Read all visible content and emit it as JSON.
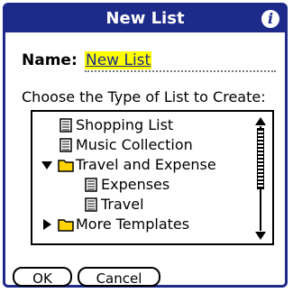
{
  "dialog": {
    "title": "New List",
    "info_icon": "info-icon"
  },
  "name_field": {
    "label": "Name:",
    "value": "New List"
  },
  "prompt": "Choose the Type of List to Create:",
  "tree": [
    {
      "label": "Shopping List",
      "icon": "list-document-icon"
    },
    {
      "label": "Music Collection",
      "icon": "list-document-icon"
    },
    {
      "label": "Travel and Expense",
      "icon": "folder-icon",
      "expanded": true
    },
    {
      "label": "Expenses",
      "icon": "list-document-icon"
    },
    {
      "label": "Travel",
      "icon": "list-document-icon"
    },
    {
      "label": "More Templates",
      "icon": "folder-icon",
      "expanded": false
    }
  ],
  "buttons": {
    "ok": "OK",
    "cancel": "Cancel"
  },
  "colors": {
    "title_bar": "#1d2a8a",
    "name_highlight": "#ffff00",
    "name_text": "#1d2a8a",
    "folder": "#ffd400"
  }
}
